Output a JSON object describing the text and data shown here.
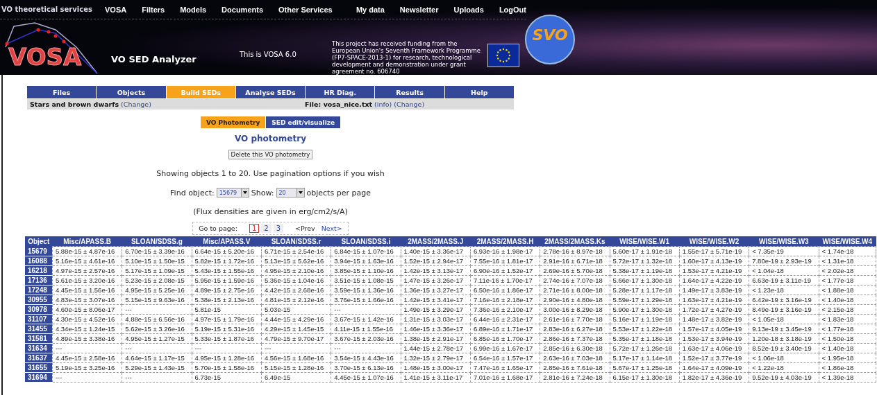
{
  "top_nav": {
    "brand": "VO theoretical services",
    "links": [
      "VOSA",
      "Filters",
      "Models",
      "Documents",
      "Other Services"
    ],
    "user_links": [
      "My data",
      "Newsletter",
      "Uploads",
      "LogOut"
    ]
  },
  "banner": {
    "logo_text": "VOSA",
    "app_name": "VO SED Analyzer",
    "version_note": "This is VOSA 6.0",
    "funding_note": "This project has received funding from the European Union's Seventh Framework Programme (FP7-SPACE-2013-1) for research, technological development and demonstration under grant agreement no. 606740",
    "svo_logo_text": "SVO"
  },
  "main_tabs": [
    {
      "label": "Files",
      "selected": false
    },
    {
      "label": "Objects",
      "selected": false
    },
    {
      "label": "Build SEDs",
      "selected": true
    },
    {
      "label": "Analyse SEDs",
      "selected": false
    },
    {
      "label": "HR Diag.",
      "selected": false
    },
    {
      "label": "Results",
      "selected": false
    },
    {
      "label": "Help",
      "selected": false
    }
  ],
  "context_bar": {
    "model_label": "Stars and brown dwarfs",
    "model_link": "(Change)",
    "file_label": "File: vosa_nice.txt",
    "file_links": [
      "(info)",
      "(Change)"
    ]
  },
  "sub_tabs": [
    {
      "label": "VO Photometry",
      "selected": true
    },
    {
      "label": "SED edit/visualize",
      "selected": false
    }
  ],
  "heading": "VO photometry",
  "delete_button": "Delete this VO photometry",
  "showing_text": "Showing objects 1 to 20. Use pagination options if you wish",
  "find": {
    "label": "Find object:",
    "value": "15679"
  },
  "show": {
    "label": "Show:",
    "value": "20",
    "suffix": "objects per page"
  },
  "units_note": "(Flux densities are given in erg/cm2/s/A)",
  "pagination": {
    "label": "Go to page:",
    "pages": [
      {
        "label": "1",
        "selected": true
      },
      {
        "label": "2",
        "selected": false
      },
      {
        "label": "3",
        "selected": false
      }
    ],
    "prev": "<Prev",
    "next": "Next>"
  },
  "table": {
    "columns": [
      "Object",
      "Misc/APASS.B",
      "SLOAN/SDSS.g",
      "Misc/APASS.V",
      "SLOAN/SDSS.r",
      "SLOAN/SDSS.i",
      "2MASS/2MASS.J",
      "2MASS/2MASS.H",
      "2MASS/2MASS.Ks",
      "WISE/WISE.W1",
      "WISE/WISE.W2",
      "WISE/WISE.W3",
      "WISE/WISE.W4"
    ],
    "rows": [
      [
        "15679",
        "5.88e-15 ± 4.87e-16",
        "6.70e-15 ± 3.39e-16",
        "6.64e-15 ± 5.20e-16",
        "6.71e-15 ± 2.54e-16",
        "6.84e-15 ± 1.07e-16",
        "1.40e-15 ± 3.36e-17",
        "6.93e-16 ± 1.98e-17",
        "2.78e-16 ± 8.97e-18",
        "5.60e-17 ± 1.91e-18",
        "1.55e-17 ± 5.71e-19",
        "< 7.35e-19",
        "< 1.74e-18"
      ],
      [
        "16088",
        "5.16e-15 ± 4.61e-16",
        "5.10e-15 ± 1.50e-15",
        "5.82e-15 ± 1.72e-16",
        "5.13e-15 ± 5.62e-16",
        "3.94e-15 ± 1.63e-16",
        "1.52e-15 ± 2.94e-17",
        "7.55e-16 ± 1.81e-17",
        "2.91e-16 ± 6.71e-18",
        "5.72e-17 ± 1.32e-18",
        "1.60e-17 ± 4.13e-19",
        "7.80e-19 ± 2.93e-19",
        "< 1.31e-18"
      ],
      [
        "16218",
        "4.97e-15 ± 2.57e-16",
        "5.17e-15 ± 1.09e-15",
        "5.43e-15 ± 1.55e-16",
        "4.95e-15 ± 2.10e-16",
        "3.85e-15 ± 1.10e-16",
        "1.42e-15 ± 3.13e-17",
        "6.90e-16 ± 1.52e-17",
        "2.69e-16 ± 5.70e-18",
        "5.38e-17 ± 1.19e-18",
        "1.53e-17 ± 4.21e-19",
        "< 1.04e-18",
        "< 2.02e-18"
      ],
      [
        "17136",
        "5.61e-15 ± 3.20e-16",
        "5.23e-15 ± 2.08e-15",
        "5.95e-15 ± 1.59e-16",
        "5.36e-15 ± 1.04e-16",
        "3.51e-15 ± 1.08e-15",
        "1.47e-15 ± 3.26e-17",
        "7.11e-16 ± 1.70e-17",
        "2.74e-16 ± 7.07e-18",
        "5.66e-17 ± 1.30e-18",
        "1.64e-17 ± 4.22e-19",
        "6.63e-19 ± 3.11e-19",
        "< 1.77e-18"
      ],
      [
        "17248",
        "4.45e-15 ± 1.56e-16",
        "4.95e-15 ± 5.25e-16",
        "4.89e-15 ± 2.75e-16",
        "4.42e-15 ± 2.68e-16",
        "3.59e-15 ± 1.36e-16",
        "1.36e-15 ± 3.27e-17",
        "6.50e-16 ± 1.86e-17",
        "2.71e-16 ± 8.00e-18",
        "5.28e-17 ± 1.17e-18",
        "1.49e-17 ± 3.83e-19",
        "< 1.23e-18",
        "< 1.88e-18"
      ],
      [
        "30955",
        "4.83e-15 ± 3.07e-16",
        "5.15e-15 ± 9.63e-16",
        "5.38e-15 ± 2.13e-16",
        "4.81e-15 ± 2.12e-16",
        "3.76e-15 ± 1.66e-16",
        "1.42e-15 ± 3.41e-17",
        "7.16e-16 ± 2.18e-17",
        "2.90e-16 ± 4.80e-18",
        "5.59e-17 ± 1.29e-18",
        "1.63e-17 ± 4.21e-19",
        "6.42e-19 ± 3.16e-19",
        "< 1.40e-18"
      ],
      [
        "30978",
        "4.60e-15 ± 8.06e-17",
        "---",
        "5.81e-15",
        "5.03e-15",
        "---",
        "1.49e-15 ± 3.29e-17",
        "7.36e-16 ± 2.10e-17",
        "3.00e-16 ± 8.29e-18",
        "5.90e-17 ± 1.30e-18",
        "1.72e-17 ± 4.27e-19",
        "8.49e-19 ± 3.16e-19",
        "< 2.15e-18"
      ],
      [
        "31107",
        "4.30e-15 ± 4.52e-16",
        "4.88e-15 ± 6.56e-16",
        "4.97e-15 ± 1.79e-16",
        "4.44e-15 ± 4.29e-16",
        "3.67e-15 ± 1.42e-16",
        "1.31e-15 ± 3.03e-17",
        "6.44e-16 ± 2.31e-17",
        "2.61e-16 ± 7.70e-18",
        "5.16e-17 ± 1.19e-18",
        "1.48e-17 ± 3.82e-19",
        "< 1.05e-18",
        "< 1.83e-18"
      ],
      [
        "31455",
        "4.34e-15 ± 1.24e-15",
        "5.62e-15 ± 3.26e-16",
        "5.19e-15 ± 5.31e-16",
        "4.29e-15 ± 1.45e-15",
        "4.11e-15 ± 1.55e-16",
        "1.46e-15 ± 3.36e-17",
        "6.89e-16 ± 1.71e-17",
        "2.83e-16 ± 6.27e-18",
        "5.53e-17 ± 1.22e-18",
        "1.57e-17 ± 4.05e-19",
        "9.13e-19 ± 3.45e-19",
        "< 1.77e-18"
      ],
      [
        "31581",
        "4.89e-15 ± 3.38e-16",
        "4.95e-15 ± 1.27e-15",
        "5.33e-15 ± 1.87e-16",
        "4.79e-15 ± 9.70e-17",
        "3.67e-15 ± 2.03e-16",
        "1.38e-15 ± 2.91e-17",
        "6.85e-16 ± 1.70e-17",
        "2.86e-16 ± 7.37e-18",
        "5.35e-17 ± 1.18e-18",
        "1.53e-17 ± 3.94e-19",
        "1.20e-18 ± 3.18e-19",
        "< 1.50e-18"
      ],
      [
        "31634",
        "---",
        "---",
        "---",
        "---",
        "---",
        "1.44e-15 ± 2.78e-17",
        "6.99e-16 ± 1.67e-17",
        "2.85e-16 ± 6.30e-18",
        "5.72e-17 ± 1.26e-18",
        "1.63e-17 ± 4.06e-19",
        "8.52e-19 ± 3.40e-19",
        "< 1.40e-18"
      ],
      [
        "31637",
        "4.45e-15 ± 2.58e-16",
        "4.64e-15 ± 1.17e-15",
        "4.95e-15 ± 1.28e-16",
        "4.56e-15 ± 1.68e-16",
        "3.54e-15 ± 4.43e-16",
        "1.32e-15 ± 2.79e-17",
        "6.54e-16 ± 1.57e-17",
        "2.63e-16 ± 7.03e-18",
        "5.17e-17 ± 1.14e-18",
        "1.52e-17 ± 3.77e-19",
        "< 1.06e-18",
        "< 1.95e-18"
      ],
      [
        "31655",
        "5.19e-15 ± 3.25e-16",
        "5.29e-15 ± 1.43e-15",
        "5.70e-15 ± 1.58e-16",
        "5.15e-15 ± 1.28e-16",
        "3.70e-15 ± 6.13e-16",
        "1.48e-15 ± 3.00e-17",
        "7.47e-16 ± 1.65e-17",
        "2.85e-16 ± 7.61e-18",
        "5.67e-17 ± 1.25e-18",
        "1.64e-17 ± 4.09e-19",
        "< 1.22e-18",
        "< 1.86e-18"
      ],
      [
        "31694",
        "---",
        "---",
        "6.73e-15",
        "6.49e-15",
        "4.45e-15 ± 1.07e-16",
        "1.41e-15 ± 3.11e-17",
        "7.01e-16 ± 1.68e-17",
        "2.81e-16 ± 7.24e-18",
        "6.15e-17 ± 1.30e-18",
        "1.82e-17 ± 4.36e-19",
        "9.52e-19 ± 4.03e-19",
        "< 1.39e-18"
      ]
    ]
  }
}
